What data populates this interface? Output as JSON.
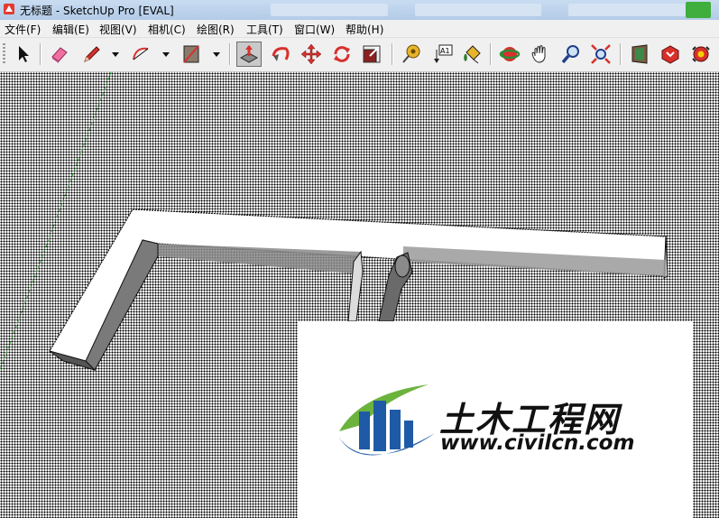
{
  "window": {
    "title": "无标题 - SketchUp Pro [EVAL]"
  },
  "menu": {
    "items": [
      "文件(F)",
      "编辑(E)",
      "视图(V)",
      "相机(C)",
      "绘图(R)",
      "工具(T)",
      "窗口(W)",
      "帮助(H)"
    ]
  },
  "toolbar": {
    "tools": [
      {
        "name": "select-tool",
        "icon": "arrow-cursor-icon"
      },
      {
        "name": "eraser-tool",
        "icon": "eraser-icon"
      },
      {
        "name": "pencil-tool",
        "icon": "pencil-icon"
      },
      {
        "name": "arc-tool",
        "icon": "arc-icon"
      },
      {
        "name": "rectangle-tool",
        "icon": "rectangle-icon"
      },
      {
        "name": "push-pull-tool",
        "icon": "push-pull-icon",
        "active": true
      },
      {
        "name": "follow-me-tool",
        "icon": "follow-me-icon"
      },
      {
        "name": "move-tool",
        "icon": "move-icon"
      },
      {
        "name": "rotate-tool",
        "icon": "rotate-icon"
      },
      {
        "name": "scale-tool",
        "icon": "scale-icon"
      },
      {
        "name": "tape-measure-tool",
        "icon": "tape-measure-icon"
      },
      {
        "name": "text-tool",
        "icon": "text-label-icon"
      },
      {
        "name": "paint-bucket-tool",
        "icon": "paint-bucket-icon"
      },
      {
        "name": "orbit-tool",
        "icon": "orbit-icon"
      },
      {
        "name": "pan-tool",
        "icon": "hand-icon"
      },
      {
        "name": "zoom-tool",
        "icon": "magnifier-icon"
      },
      {
        "name": "zoom-extents-tool",
        "icon": "zoom-extents-icon"
      },
      {
        "name": "get-models-tool",
        "icon": "3d-warehouse-icon"
      },
      {
        "name": "share-model-tool",
        "icon": "share-model-icon"
      },
      {
        "name": "extension-warehouse-tool",
        "icon": "extension-warehouse-icon"
      }
    ],
    "text_tool_label": "A1"
  },
  "watermark": {
    "brand_cn": "土木工程网",
    "url": "www.civilcn.com"
  },
  "colors": {
    "accent_blue": "#1f5aa6",
    "accent_green": "#6cb33e",
    "eraser_pink": "#f06fa0",
    "tool_red": "#d8302c"
  }
}
